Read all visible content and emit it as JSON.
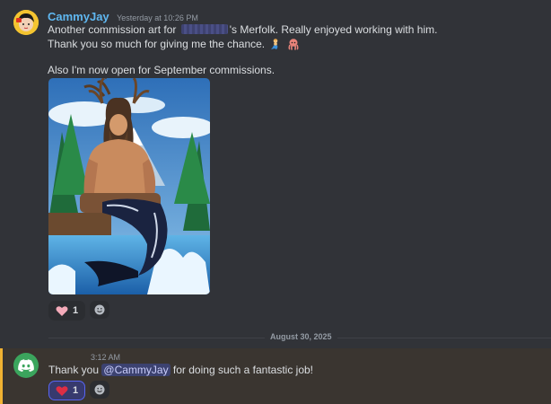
{
  "message1": {
    "username": "CammyJay",
    "timestamp": "Yesterday at 10:26 PM",
    "line1_before": "Another commission art for",
    "line1_after": "'s Merfolk. Really enjoyed working with him.",
    "line2": "Thank you so much for giving me the chance.",
    "line3": "Also I'm now open for September commissions.",
    "line2_emojis": [
      "merperson-emoji",
      "octopus-emoji"
    ],
    "reaction": {
      "emoji": "pink-heart-emoji",
      "count": "1"
    }
  },
  "divider": {
    "date": "August 30, 2025"
  },
  "message2": {
    "time": "3:12 AM",
    "text_before": "Thank you",
    "mention": "@CammyJay",
    "text_after": "for doing such a fantastic job!",
    "reaction": {
      "emoji": "red-heart-emoji",
      "count": "1"
    }
  },
  "colors": {
    "background": "#313338",
    "username": "#5fb7f0",
    "highlight_bar": "#f0b232",
    "highlight_bg": "#3a3530",
    "mention_bg": "#3c4270",
    "discord_avatar": "#3ba55d"
  }
}
